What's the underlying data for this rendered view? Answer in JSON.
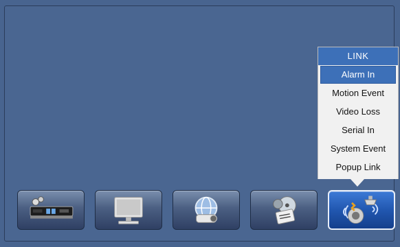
{
  "link_menu": {
    "title": "LINK",
    "items": [
      {
        "label": "Alarm In",
        "selected": true
      },
      {
        "label": "Motion Event",
        "selected": false
      },
      {
        "label": "Video Loss",
        "selected": false
      },
      {
        "label": "Serial In",
        "selected": false
      },
      {
        "label": "System Event",
        "selected": false
      },
      {
        "label": "Popup Link",
        "selected": false
      }
    ]
  },
  "taskbar": {
    "buttons": [
      {
        "icon": "dvr-recorder-icon",
        "active": false
      },
      {
        "icon": "monitor-icon",
        "active": false
      },
      {
        "icon": "network-camera-icon",
        "active": false
      },
      {
        "icon": "disc-storage-icon",
        "active": false
      },
      {
        "icon": "alarm-speaker-icon",
        "active": true
      }
    ]
  },
  "colors": {
    "background": "#48648f",
    "menu_highlight": "#3d70b8",
    "menu_background": "#f1f1f1"
  }
}
